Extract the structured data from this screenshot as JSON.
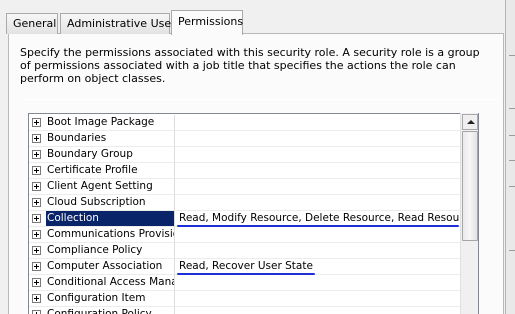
{
  "tabs": [
    {
      "label": "General"
    },
    {
      "label": "Administrative Users"
    },
    {
      "label": "Permissions"
    }
  ],
  "active_tab": "Permissions",
  "description": "Specify the permissions associated with this security role. A security role is a group of permissions associated with a job title that specifies the actions the role can perform on object classes.",
  "grid": {
    "rows": [
      {
        "name": "Boot Image Package",
        "permissions": ""
      },
      {
        "name": "Boundaries",
        "permissions": ""
      },
      {
        "name": "Boundary Group",
        "permissions": ""
      },
      {
        "name": "Certificate Profile",
        "permissions": ""
      },
      {
        "name": "Client Agent Setting",
        "permissions": ""
      },
      {
        "name": "Cloud Subscription",
        "permissions": ""
      },
      {
        "name": "Collection",
        "permissions": "Read, Modify Resource, Delete Resource, Read Resource",
        "selected": true
      },
      {
        "name": "Communications Provisioni",
        "permissions": ""
      },
      {
        "name": "Compliance Policy",
        "permissions": ""
      },
      {
        "name": "Computer Association",
        "permissions": "Read, Recover User State"
      },
      {
        "name": "Conditional Access Manag",
        "permissions": ""
      },
      {
        "name": "Configuration Item",
        "permissions": ""
      },
      {
        "name": "Configuration Policy",
        "permissions": ""
      }
    ]
  },
  "annotation_color": "#1e2fd6",
  "selection_color": "#0a246a"
}
